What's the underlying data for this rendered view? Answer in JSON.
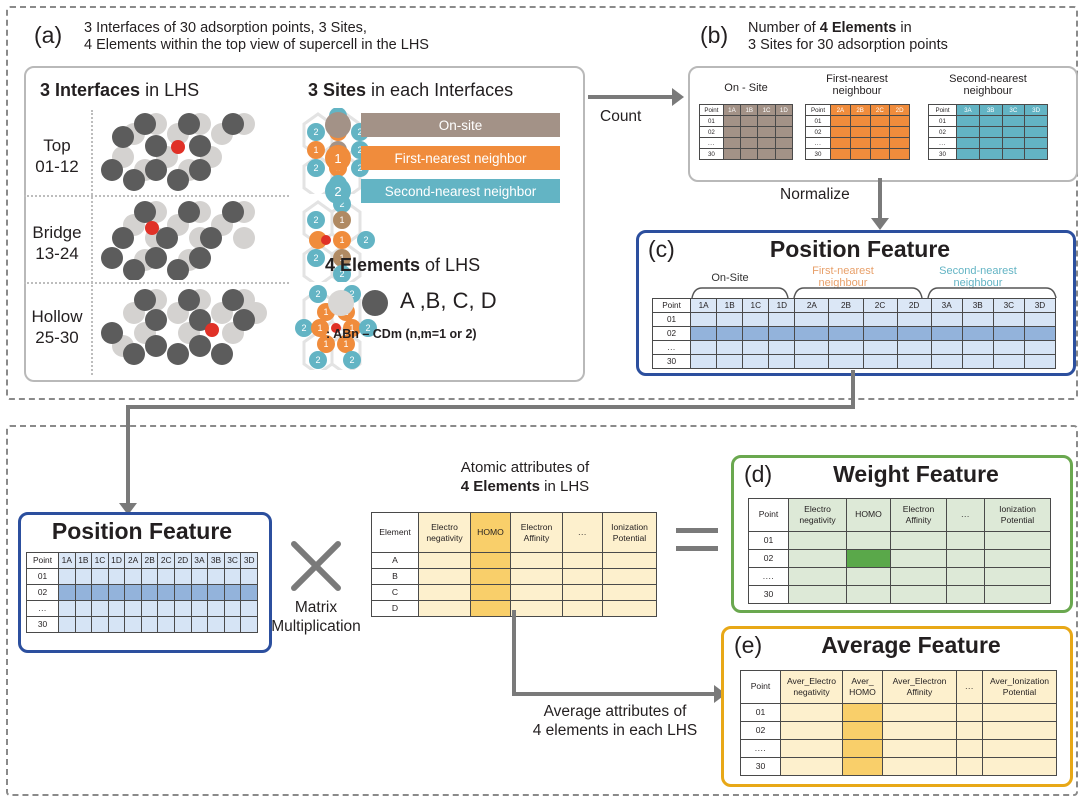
{
  "panels": {
    "a": {
      "tag": "(a)",
      "caption_line1": "3 Interfaces of 30 adsorption points, 3 Sites,",
      "caption_line2": "4 Elements within the top view of supercell in the LHS",
      "interfaces_heading_bold": "3 Interfaces",
      "interfaces_heading_rest": " in LHS",
      "interfaces": [
        {
          "name": "Top",
          "range": "01-12"
        },
        {
          "name": "Bridge",
          "range": "13-24"
        },
        {
          "name": "Hollow",
          "range": "25-30"
        }
      ],
      "sites_heading_bold": "3 Sites",
      "sites_heading_rest": " in each Interfaces",
      "sites": [
        {
          "badge": "",
          "label": "On-site",
          "color": "#a39287"
        },
        {
          "badge": "1",
          "label": "First-nearest neighbor",
          "color": "#f08c3c"
        },
        {
          "badge": "2",
          "label": "Second-nearest neighbor",
          "color": "#63b4c4"
        }
      ],
      "elements_heading_bold": "4 Elements",
      "elements_heading_rest": " of LHS",
      "elements_label": "A ,B, C, D",
      "elements_formula": ": ABn – CDm  (n,m=1 or 2)"
    },
    "b": {
      "tag": "(b)",
      "caption_line1_pre": "Number of ",
      "caption_line1_bold": "4 Elements",
      "caption_line1_post": " in",
      "caption_line2": "3 Sites for 30  adsorption points",
      "tables": [
        {
          "title": "On - Site",
          "headers": [
            "Point",
            "1A",
            "1B",
            "1C",
            "1D"
          ],
          "rows": [
            "01",
            "02",
            "...",
            "30"
          ],
          "color": "#a39287"
        },
        {
          "title": "First-nearest neighbour",
          "headers": [
            "Point",
            "2A",
            "2B",
            "2C",
            "2D"
          ],
          "rows": [
            "01",
            "02",
            "...",
            "30"
          ],
          "color": "#f08c3c"
        },
        {
          "title": "Second-nearest neighbour",
          "headers": [
            "Point",
            "3A",
            "3B",
            "3C",
            "3D"
          ],
          "rows": [
            "01",
            "02",
            "...",
            "30"
          ],
          "color": "#63b4c4"
        }
      ]
    },
    "c": {
      "tag": "(c)",
      "title": "Position Feature",
      "group_labels": [
        "On-Site",
        "First-nearest neighbour",
        "Second-nearest neighbour"
      ],
      "headers": [
        "Point",
        "1A",
        "1B",
        "1C",
        "1D",
        "2A",
        "2B",
        "2C",
        "2D",
        "3A",
        "3B",
        "3C",
        "3D"
      ],
      "rows": [
        "01",
        "02",
        "...",
        "30"
      ],
      "highlight_row": "02"
    },
    "position_bottom": {
      "title": "Position Feature",
      "headers": [
        "Point",
        "1A",
        "1B",
        "1C",
        "1D",
        "2A",
        "2B",
        "2C",
        "2D",
        "3A",
        "3B",
        "3C",
        "3D"
      ],
      "rows": [
        "01",
        "02",
        "...",
        "30"
      ],
      "highlight_row": "02"
    },
    "attributes": {
      "caption_line1": "Atomic attributes of",
      "caption_line2_bold": "4 Elements",
      "caption_line2_rest": " in LHS",
      "headers": [
        "Element",
        "Electro negativity",
        "HOMO",
        "Electron Affinity",
        "...",
        "Ionization Potential"
      ],
      "rows": [
        "A",
        "B",
        "C",
        "D"
      ],
      "highlight_column": "HOMO"
    },
    "d": {
      "tag": "(d)",
      "title": "Weight Feature",
      "headers": [
        "Point",
        "Electro negativity",
        "HOMO",
        "Electron Affinity",
        "...",
        "Ionization Potential"
      ],
      "rows": [
        "01",
        "02",
        "....",
        "30"
      ],
      "highlight_cell": {
        "row": "02",
        "column": "HOMO"
      }
    },
    "e": {
      "tag": "(e)",
      "title": "Average Feature",
      "headers": [
        "Point",
        "Aver_Electro negativity",
        "Aver_ HOMO",
        "Aver_Electron Affinity",
        "...",
        "Aver_Ionization Potential"
      ],
      "rows": [
        "01",
        "02",
        "....",
        "30"
      ],
      "highlight_column": "Aver_ HOMO"
    }
  },
  "connectors": {
    "count": "Count",
    "normalize": "Normalize",
    "matrix_multiplication_line1": "Matrix",
    "matrix_multiplication_line2": "Multiplication",
    "average_line1": "Average attributes of",
    "average_line2": "4 elements in each LHS",
    "times_symbol": "×",
    "equals_symbol": "="
  },
  "colors": {
    "on_site": "#a39287",
    "first_nearest": "#f08c3c",
    "second_nearest": "#63b4c4",
    "position_panel": "#2c4f9e",
    "weight_panel": "#6aa84f",
    "average_panel": "#e8a817",
    "atom_light": "#d4d2d0",
    "atom_dark": "#5c5c5c",
    "adsorbate": "#e03127"
  }
}
